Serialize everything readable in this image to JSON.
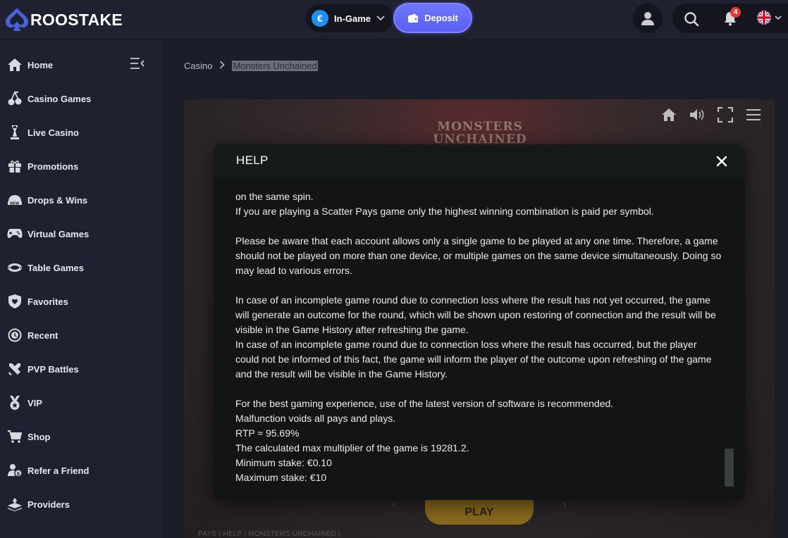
{
  "brand": {
    "name": "ROOSTAKE"
  },
  "header": {
    "currency_label": "In-Game",
    "currency_symbol": "€",
    "deposit_label": "Deposit",
    "notifications_count": "4",
    "accent_color": "#5a5ff2"
  },
  "sidebar": {
    "items": [
      {
        "label": "Home",
        "icon": "home-icon"
      },
      {
        "label": "Casino Games",
        "icon": "cherries-icon"
      },
      {
        "label": "Live Casino",
        "icon": "chess-piece-icon"
      },
      {
        "label": "Promotions",
        "icon": "gift-icon"
      },
      {
        "label": "Drops & Wins",
        "icon": "drops-wins-icon"
      },
      {
        "label": "Virtual Games",
        "icon": "gamepad-icon"
      },
      {
        "label": "Table Games",
        "icon": "table-icon"
      },
      {
        "label": "Favorites",
        "icon": "heart-shield-icon"
      },
      {
        "label": "Recent",
        "icon": "clock-icon"
      },
      {
        "label": "PVP Battles",
        "icon": "swords-icon"
      },
      {
        "label": "VIP",
        "icon": "medal-icon"
      },
      {
        "label": "Shop",
        "icon": "cart-icon"
      },
      {
        "label": "Refer a Friend",
        "icon": "refer-friend-icon"
      },
      {
        "label": "Providers",
        "icon": "providers-icon"
      }
    ]
  },
  "breadcrumb": {
    "parent": "Casino",
    "current": "Monsters Unchained"
  },
  "game": {
    "title_line1": "MONSTERS",
    "title_line2": "UNCHAINED",
    "play_label": "PLAY",
    "footer": "PAYS | HELP | MONSTERS UNCHAINED |"
  },
  "help": {
    "title": "HELP",
    "paragraphs": [
      [
        "on the same spin.",
        "If you are playing a Scatter Pays game only the highest winning combination is paid per symbol."
      ],
      [
        "Please be aware that each account allows only a single game to be played at any one time. Therefore, a game should not be played on more than one device, or multiple games on the same device simultaneously. Doing so may lead to various errors."
      ],
      [
        "In case of an incomplete game round due to connection loss where the result has not yet occurred, the game will generate an outcome for the round, which will be shown upon restoring of connection and the result will be visible in the Game History after refreshing the game.",
        "In case of an incomplete game round due to connection loss where the result has occurred, but the player could not be informed of this fact, the game will inform the player of the outcome upon refreshing of the game and the result will be visible in the Game History."
      ],
      [
        "For the best gaming experience, use of the latest version of software is recommended.",
        "Malfunction voids all pays and plays.",
        "RTP ≈ 95.69%",
        "The calculated max multiplier of the game is 19281.2.",
        "Minimum stake: €0.10",
        "Maximum stake: €10"
      ]
    ]
  }
}
